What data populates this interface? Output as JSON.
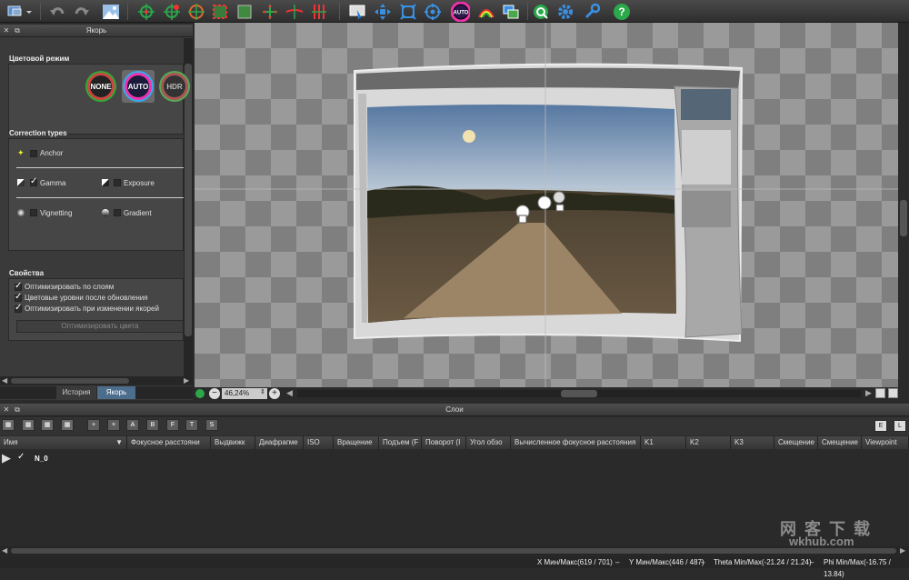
{
  "panels": {
    "anchor_title": "Якорь",
    "layers_title": "Слои"
  },
  "color_mode": {
    "title": "Цветовой режим",
    "buttons": [
      "NONE",
      "AUTO",
      "HDR"
    ]
  },
  "correction": {
    "title": "Correction types",
    "items": [
      {
        "label": "Anchor",
        "checked": false
      },
      {
        "label": "Gamma",
        "checked": true
      },
      {
        "label": "Exposure",
        "checked": false
      },
      {
        "label": "Vignetting",
        "checked": false
      },
      {
        "label": "Gradient",
        "checked": false
      }
    ]
  },
  "properties": {
    "title": "Свойства",
    "items": [
      {
        "label": "Оптимизировать по слоям",
        "checked": true
      },
      {
        "label": "Цветовые уровни после обновления",
        "checked": true
      },
      {
        "label": "Оптимизировать при изменении якорей",
        "checked": true
      }
    ],
    "optimize_button": "Оптимизировать цвета"
  },
  "tabs": [
    "История",
    "Якорь"
  ],
  "zoom": {
    "value": "46,24%"
  },
  "layers": {
    "columns": [
      "Имя",
      "Фокусное расстояни",
      "Выдвижк",
      "Диафрагме",
      "ISO",
      "Вращение",
      "Подъем (F",
      "Поворот (I",
      "Угол обзо",
      "Вычисленное фокусное расстояния",
      "K1",
      "K2",
      "K3",
      "Смещение",
      "Смещение",
      "Viewpoint"
    ],
    "rows": [
      {
        "name": "N_0"
      }
    ],
    "right_buttons": [
      "E",
      "L"
    ],
    "tool_buttons": [
      "+",
      "×",
      "A",
      "B",
      "F",
      "T",
      "S"
    ]
  },
  "status": {
    "x": "X Мин/Макс(619 / 701)",
    "y": "Y Мин/Макс(446 / 487)",
    "theta": "Theta Min/Max(-21.24 / 21.24)",
    "phi": "Phi Min/Max(-16.75 / 13.84)",
    "sep": "–"
  },
  "watermark": {
    "cn": "网 客 下 载",
    "url": "wkhub.com"
  },
  "colors": {
    "accent_tab": "#4d6d8d",
    "none_btn": "#222222",
    "auto_btn": "#1a1a2a",
    "hdr_btn": "#333333"
  },
  "icons": [
    "display-icon",
    "undo-icon",
    "redo-icon",
    "photo-icon",
    "target-icon",
    "crop-icon",
    "move-icon",
    "fit-icon",
    "auto-icon",
    "settings-icon",
    "wrench-icon",
    "help-icon"
  ]
}
